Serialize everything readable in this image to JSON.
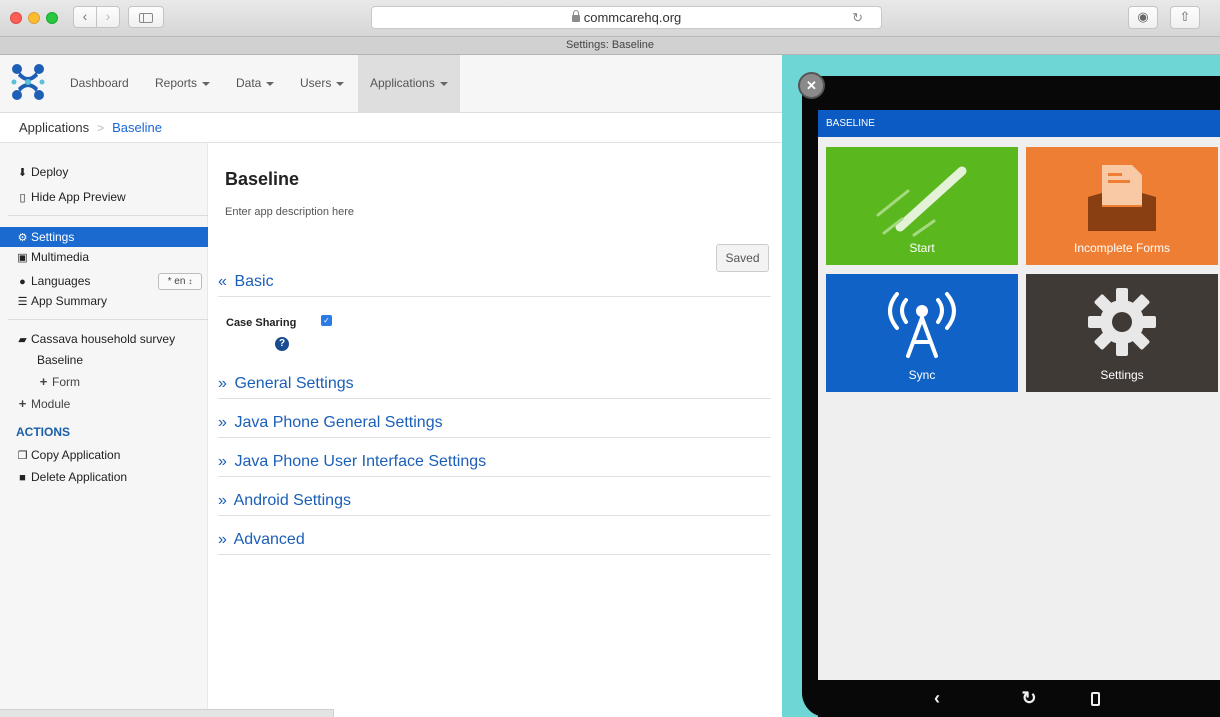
{
  "browser": {
    "url": "commcarehq.org",
    "tab_title": "Settings: Baseline"
  },
  "topnav": {
    "items": [
      {
        "label": "Dashboard",
        "dropdown": false
      },
      {
        "label": "Reports",
        "dropdown": true
      },
      {
        "label": "Data",
        "dropdown": true
      },
      {
        "label": "Users",
        "dropdown": true
      },
      {
        "label": "Applications",
        "dropdown": true,
        "active": true
      }
    ]
  },
  "breadcrumb": {
    "root": "Applications",
    "separator": ">",
    "current": "Baseline"
  },
  "sidebar": {
    "deploy": "Deploy",
    "hide_preview": "Hide App Preview",
    "settings": "Settings",
    "multimedia": "Multimedia",
    "languages": "Languages",
    "language_value": "* en",
    "app_summary": "App Summary",
    "module_name": "Cassava household survey",
    "form_name": "Baseline",
    "add_form": "Form",
    "add_module": "Module",
    "actions_heading": "ACTIONS",
    "copy_app": "Copy Application",
    "delete_app": "Delete Application"
  },
  "main": {
    "title": "Baseline",
    "description_placeholder": "Enter app description here",
    "saved_label": "Saved",
    "sections": {
      "basic": "Basic",
      "general": "General Settings",
      "java_general": "Java Phone General Settings",
      "java_ui": "Java Phone User Interface Settings",
      "android": "Android Settings",
      "advanced": "Advanced"
    },
    "case_sharing_label": "Case Sharing",
    "case_sharing_checked": true
  },
  "preview": {
    "header": "BASELINE",
    "tiles": {
      "start": "Start",
      "incomplete": "Incomplete Forms",
      "sync": "Sync",
      "settings": "Settings"
    },
    "colors": {
      "start": "#5ab71d",
      "incomplete": "#ee7e34",
      "sync": "#1062c6",
      "settings": "#403a37",
      "header": "#0c5ac4"
    }
  }
}
